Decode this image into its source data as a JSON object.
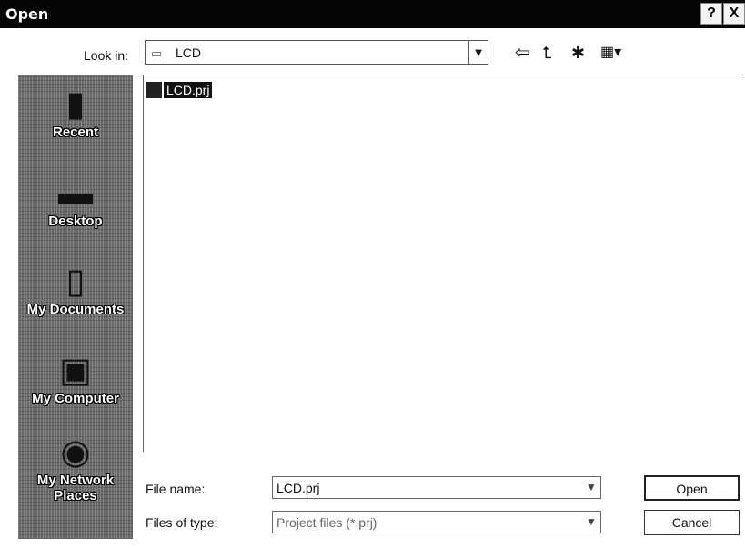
{
  "window": {
    "title": "Open",
    "help_glyph": "?",
    "close_glyph": "X"
  },
  "lookin": {
    "label": "Look in:",
    "value": "LCD"
  },
  "places": [
    {
      "label": "Recent",
      "icon": "recent-icon"
    },
    {
      "label": "Desktop",
      "icon": "desktop-icon"
    },
    {
      "label": "My Documents",
      "icon": "my-documents-icon"
    },
    {
      "label": "My Computer",
      "icon": "my-computer-icon"
    },
    {
      "label": "My Network Places",
      "icon": "my-network-places-icon"
    }
  ],
  "files": [
    {
      "name": "LCD.prj",
      "selected": true
    }
  ],
  "filename": {
    "label": "File name:",
    "value": "LCD.prj"
  },
  "filetype": {
    "label": "Files of type:",
    "value": "Project files (*.prj)"
  },
  "buttons": {
    "open": "Open",
    "cancel": "Cancel"
  }
}
